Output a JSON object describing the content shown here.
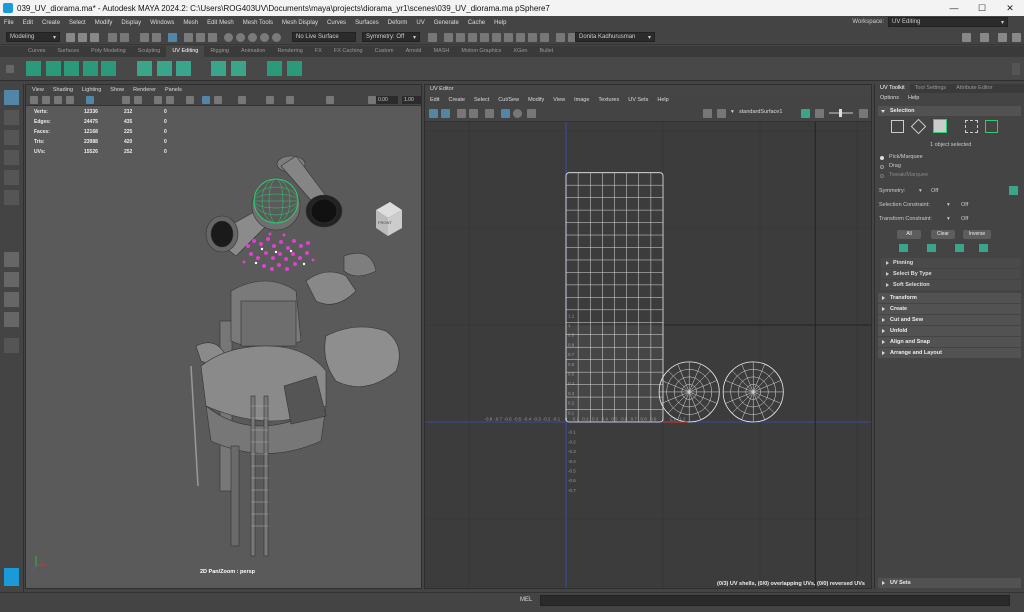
{
  "window": {
    "title": "039_UV_diorama.ma* - Autodesk MAYA 2024.2: C:\\Users\\ROG403UV\\Documents\\maya\\projects\\diorama_yr1\\scenes\\039_UV_diorama.ma    pSphere7",
    "minimize": "—",
    "maximize": "☐",
    "close": "✕"
  },
  "menubar": [
    "File",
    "Edit",
    "Create",
    "Select",
    "Modify",
    "Display",
    "Windows",
    "Mesh",
    "Edit Mesh",
    "Mesh Tools",
    "Mesh Display",
    "Curves",
    "Surfaces",
    "Deform",
    "UV",
    "Generate",
    "Cache",
    "Help"
  ],
  "workspace": {
    "label": "Workspace:",
    "value": "UV Editing"
  },
  "statusline": {
    "mode": "Modeling",
    "live_surface": "No Live Surface",
    "symmetry": "Symmetry: Off",
    "user": "Donita Kadhurusman"
  },
  "shelf_tabs": [
    "Curves",
    "Surfaces",
    "Poly Modeling",
    "Sculpting",
    "UV Editing",
    "Rigging",
    "Animation",
    "Rendering",
    "FX",
    "FX Caching",
    "Custom",
    "Arnold",
    "MASH",
    "Motion Graphics",
    "XGen",
    "Bullet"
  ],
  "shelf_active": "UV Editing",
  "viewport": {
    "menu": [
      "View",
      "Shading",
      "Lighting",
      "Show",
      "Renderer",
      "Panels"
    ],
    "field1": "0.00",
    "field2": "1.00",
    "hud": [
      {
        "label": "Verts:",
        "a": "12336",
        "b": "212",
        "c": "0"
      },
      {
        "label": "Edges:",
        "a": "24475",
        "b": "435",
        "c": "0"
      },
      {
        "label": "Faces:",
        "a": "12168",
        "b": "225",
        "c": "0"
      },
      {
        "label": "Tris:",
        "a": "23988",
        "b": "420",
        "c": "0"
      },
      {
        "label": "UVs:",
        "a": "15526",
        "b": "252",
        "c": "0"
      }
    ],
    "viewcube": "FRONT",
    "camera_label": "2D Pan/Zoom : persp"
  },
  "uv_editor": {
    "title": "UV Editor",
    "menu": [
      "Edit",
      "Create",
      "Select",
      "Cut/Sew",
      "Modify",
      "View",
      "Image",
      "Textures",
      "UV Sets",
      "Help"
    ],
    "shader": "standardSurface1",
    "x_ticks": [
      "-0.8",
      "-0.7",
      "-0.6",
      "-0.5",
      "-0.4",
      "-0.3",
      "-0.2",
      "-0.1",
      "0",
      "0.1",
      "0.2",
      "0.3",
      "0.4",
      "0.5",
      "0.6",
      "0.7",
      "0.8",
      "0.9",
      "1",
      "1.1",
      "1.2"
    ],
    "y_ticks": [
      "1.1",
      "1",
      "0.9",
      "0.8",
      "0.7",
      "0.6",
      "0.5",
      "0.4",
      "0.3",
      "0.2",
      "0.1",
      "-0.1",
      "-0.2",
      "-0.3",
      "-0.4",
      "-0.5",
      "-0.6",
      "-0.7"
    ],
    "status": "(0/3) UV shells, (0/0) overlapping UVs, (0/0) reversed UVs"
  },
  "toolkit": {
    "tabs": [
      "UV Toolkit",
      "Tool Settings",
      "Attribute Editor"
    ],
    "menu": [
      "Options",
      "Help"
    ],
    "selection_header": "Selection",
    "selected_text": "1 object selected",
    "pick_modes": [
      "Pick/Marquee",
      "Drag",
      "Tweak/Marquee"
    ],
    "symmetry_label": "Symmetry:",
    "symmetry_value": "Off",
    "sel_constraint_label": "Selection Constraint:",
    "sel_constraint_value": "Off",
    "tr_constraint_label": "Transform Constraint:",
    "tr_constraint_value": "Off",
    "buttons": [
      "All",
      "Clear",
      "Inverse"
    ],
    "subsections": [
      "Pinning",
      "Select By Type",
      "Soft Selection"
    ],
    "sections": [
      "Transform",
      "Create",
      "Cut and Sew",
      "Unfold",
      "Align and Snap",
      "Arrange and Layout"
    ],
    "uv_sets": "UV Sets"
  },
  "bottom": {
    "mel": "MEL"
  },
  "colors": {
    "accent": "#5285a6",
    "uv_green": "#2ecc71",
    "particles": "#e040d0"
  }
}
